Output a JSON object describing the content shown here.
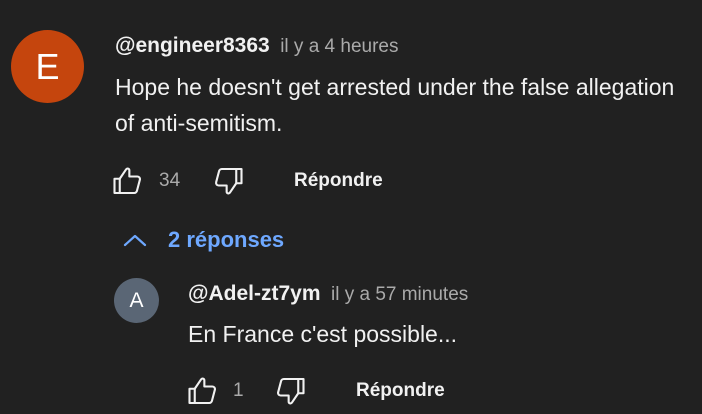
{
  "comment": {
    "avatar_letter": "E",
    "author": "@engineer8363",
    "time": "il y a 4 heures",
    "text": "Hope he doesn't get arrested under the false allegation of anti-semitism.",
    "likes": "34",
    "reply_label": "Répondre",
    "avatar_color": "#c5450d"
  },
  "replies_toggle": {
    "label": "2 réponses",
    "icon": "chevron-up-icon",
    "color": "#6ea8ff"
  },
  "reply": {
    "avatar_letter": "A",
    "author": "@Adel-zt7ym",
    "time": "il y a 57 minutes",
    "text": "En France c'est possible...",
    "likes": "1",
    "reply_label": "Répondre",
    "avatar_color": "#5a6675"
  }
}
